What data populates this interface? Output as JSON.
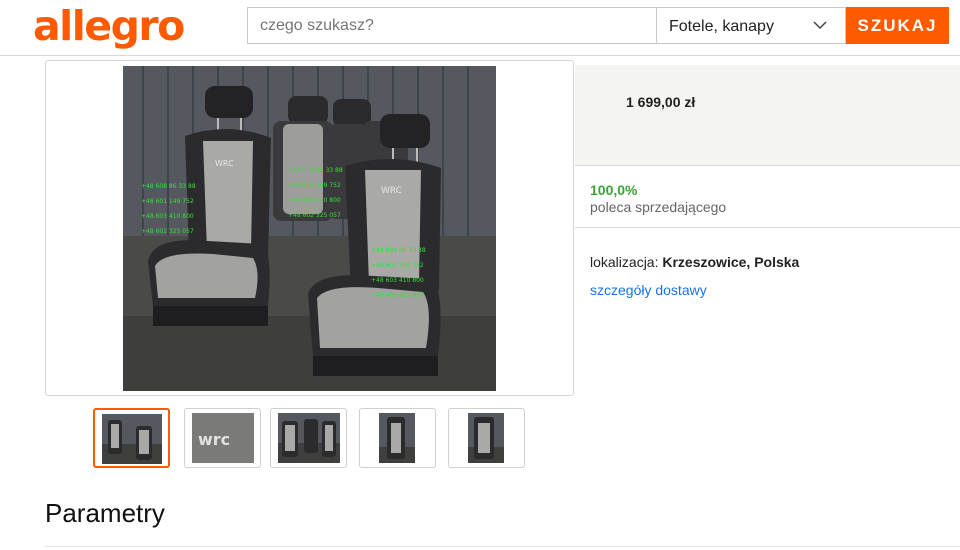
{
  "header": {
    "logo_text": "allegro",
    "search_placeholder": "czego szukasz?",
    "category_selected": "Fotele, kanapy",
    "search_button": "SZUKAJ"
  },
  "gallery": {
    "photo_overlay_numbers": [
      "+48 608 86 33 88",
      "+48 601 149 752",
      "+48 603 410 800",
      "+48 602 325 057"
    ],
    "thumbnail_count": 5,
    "active_thumbnail_index": 0
  },
  "offer": {
    "price": "1 699,00 zł",
    "recommend_percent": "100,0%",
    "recommend_label": "poleca sprzedającego",
    "location_label": "lokalizacja: ",
    "location_value": "Krzeszowice, Polska",
    "delivery_link": "szczegóły dostawy"
  },
  "sections": {
    "parameters_title": "Parametry"
  },
  "colors": {
    "brand": "#ff5a00",
    "recommend": "#3aa335",
    "link": "#1a73e8"
  }
}
